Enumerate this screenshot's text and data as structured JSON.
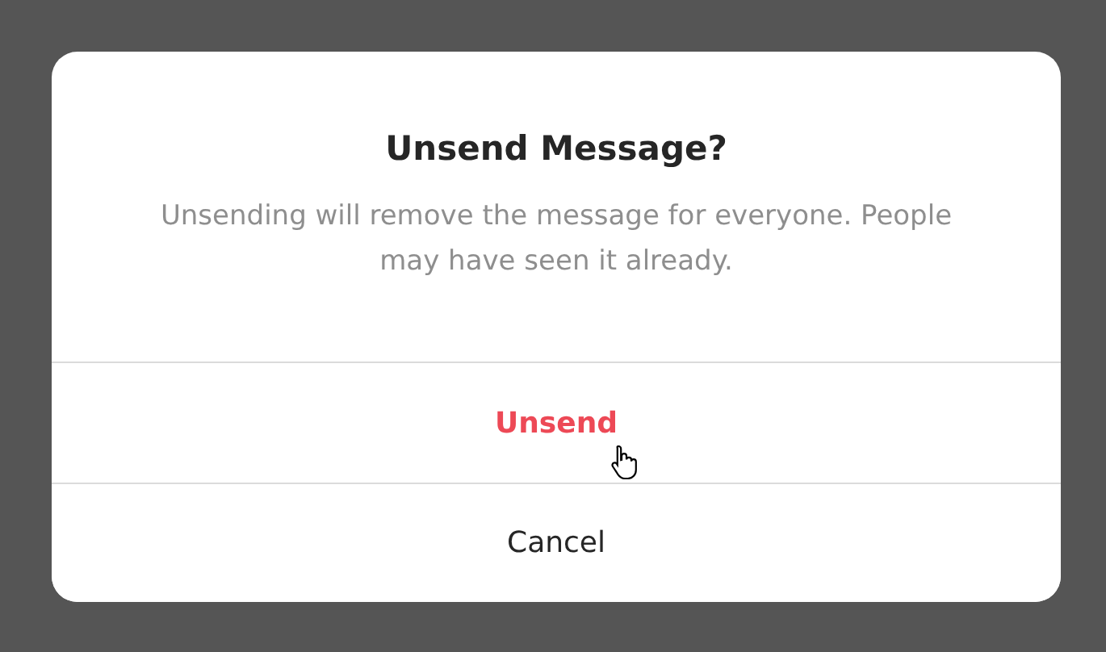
{
  "dialog": {
    "title": "Unsend Message?",
    "message": "Unsending will remove the message for everyone. People may have seen it already.",
    "actions": [
      {
        "label": "Unsend",
        "kind": "danger",
        "hovered": true
      },
      {
        "label": "Cancel",
        "kind": "plain",
        "hovered": false
      }
    ]
  }
}
